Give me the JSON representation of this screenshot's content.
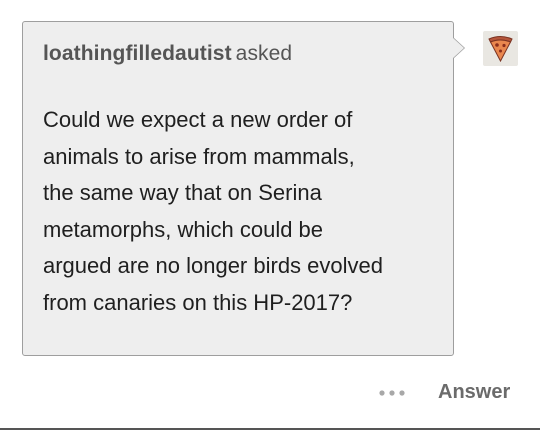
{
  "ask": {
    "asker_name": "loathingfilledautist",
    "asked_label": "asked",
    "question_lines": [
      "Could we expect a new order of",
      "animals to arise from mammals,",
      "the same way that on Serina",
      "metamorphs, which could be",
      "argued are no longer birds evolved",
      "from canaries on this HP-2017?"
    ]
  },
  "avatar": {
    "icon": "pizza-slice-icon"
  },
  "footer": {
    "more_icon": "ellipsis-icon",
    "answer_label": "Answer"
  },
  "colors": {
    "bubble_background": "#eeeeee",
    "bubble_border": "#9e9e9e",
    "text": "#1f1f1f",
    "muted": "#6b6b6b"
  }
}
